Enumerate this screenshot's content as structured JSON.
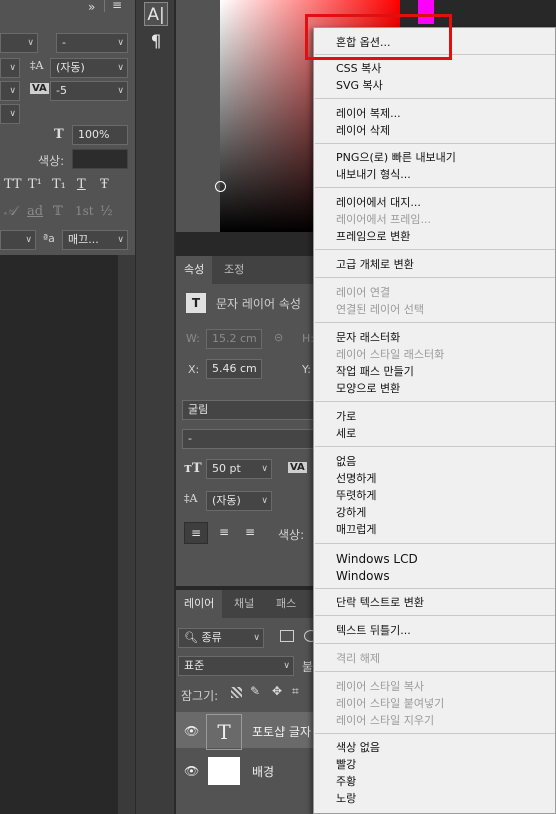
{
  "left_panel": {
    "dash_value": "-",
    "leading_value": "(자동)",
    "tracking_value": "-5",
    "scale_value": "100%",
    "color_label": "색상:",
    "style_glyphs": [
      "TT",
      "T¹",
      "T₁",
      "T",
      "Ŧ"
    ],
    "otype_glyphs": [
      "𝒜",
      "ad",
      "𝕋",
      "1st",
      "½"
    ],
    "lang_label": "ªa",
    "aa_value": "매끄..."
  },
  "tools": {
    "char_icon": "A|",
    "para_icon": "¶"
  },
  "properties": {
    "tabs": [
      "속성",
      "조정"
    ],
    "layer_type": "문자 레이어 속성",
    "w_label": "W:",
    "w_value": "15.2 cm",
    "h_label": "H:",
    "x_label": "X:",
    "x_value": "5.46 cm",
    "y_label": "Y:",
    "font_value": "굴림",
    "style_value": "-",
    "size_value": "50 pt",
    "leading_value": "(자동)",
    "color_label": "색상:"
  },
  "layers": {
    "tabs": [
      "레이어",
      "채널",
      "패스"
    ],
    "filter_label": "종류",
    "blend_value": "표준",
    "opacity_abbr": "불",
    "lock_label": "잠그기:",
    "items": [
      {
        "name": "포토샵 글자",
        "type": "text"
      },
      {
        "name": "배경",
        "type": "image"
      }
    ]
  },
  "context_menu": {
    "items": [
      {
        "label": "혼합 옵션...",
        "disabled": false
      },
      {
        "label": "CSS 복사",
        "disabled": false
      },
      {
        "label": "SVG 복사",
        "disabled": false
      },
      {
        "label": "레이어 복제...",
        "disabled": false
      },
      {
        "label": "레이어 삭제",
        "disabled": false
      },
      {
        "label": "PNG으(로) 빠른 내보내기",
        "disabled": false
      },
      {
        "label": "내보내기 형식...",
        "disabled": false
      },
      {
        "label": "레이어에서 대지...",
        "disabled": false
      },
      {
        "label": "레이어에서 프레임...",
        "disabled": true
      },
      {
        "label": "프레임으로 변환",
        "disabled": false
      },
      {
        "label": "고급 개체로 변환",
        "disabled": false
      },
      {
        "label": "레이어 연결",
        "disabled": true
      },
      {
        "label": "연결된 레이어 선택",
        "disabled": true
      },
      {
        "label": "문자 래스터화",
        "disabled": false
      },
      {
        "label": "레이어 스타일 래스터화",
        "disabled": true
      },
      {
        "label": "작업 패스 만들기",
        "disabled": false
      },
      {
        "label": "모양으로 변환",
        "disabled": false
      },
      {
        "label": "가로",
        "disabled": false
      },
      {
        "label": "세로",
        "disabled": false
      },
      {
        "label": "없음",
        "disabled": false
      },
      {
        "label": "선명하게",
        "disabled": false
      },
      {
        "label": "뚜렷하게",
        "disabled": false
      },
      {
        "label": "강하게",
        "disabled": false
      },
      {
        "label": "매끄럽게",
        "disabled": false
      },
      {
        "label": "Windows LCD",
        "disabled": false
      },
      {
        "label": "Windows",
        "disabled": false
      },
      {
        "label": "단락 텍스트로 변환",
        "disabled": false
      },
      {
        "label": "텍스트 뒤틀기...",
        "disabled": false
      },
      {
        "label": "격리 해제",
        "disabled": true
      },
      {
        "label": "레이어 스타일 복사",
        "disabled": true
      },
      {
        "label": "레이어 스타일 붙여넣기",
        "disabled": true
      },
      {
        "label": "레이어 스타일 지우기",
        "disabled": true
      },
      {
        "label": "색상 없음",
        "disabled": false
      },
      {
        "label": "빨강",
        "disabled": false
      },
      {
        "label": "주황",
        "disabled": false
      },
      {
        "label": "노랑",
        "disabled": false
      }
    ]
  },
  "colors": {
    "menu_bg": "#f0f0f0",
    "highlight": "#e01010",
    "panel_bg": "#535353",
    "hue_swatch": "#ff00ff"
  }
}
